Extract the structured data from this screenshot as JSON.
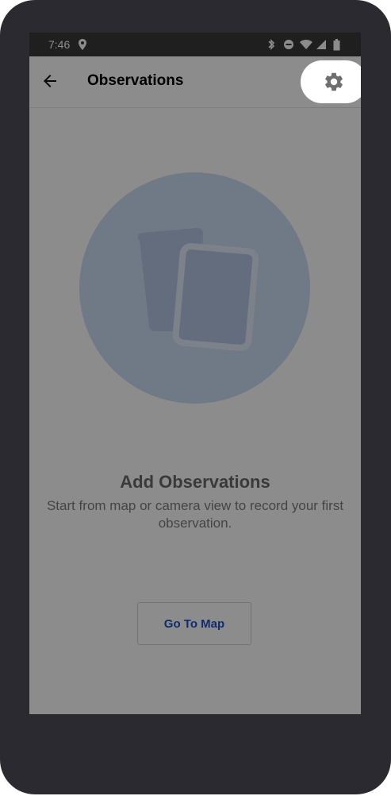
{
  "status_bar": {
    "time": "7:46",
    "icons": [
      "location-icon",
      "bluetooth-icon",
      "do-not-disturb-icon",
      "wifi-icon",
      "signal-icon",
      "battery-icon"
    ]
  },
  "app_bar": {
    "title": "Observations",
    "back_icon": "arrow-back-icon",
    "settings_icon": "gear-icon"
  },
  "empty_state": {
    "illustration_icon": "observation-cards-icon",
    "title": "Add Observations",
    "subtitle": "Start from map or camera view to record your first observation.",
    "button_label": "Go To Map"
  },
  "colors": {
    "frame": "#2b2a31",
    "circle": "#cddcf5",
    "button_text": "#1e50c8",
    "scrim": "rgba(0,0,0,0.45)"
  }
}
